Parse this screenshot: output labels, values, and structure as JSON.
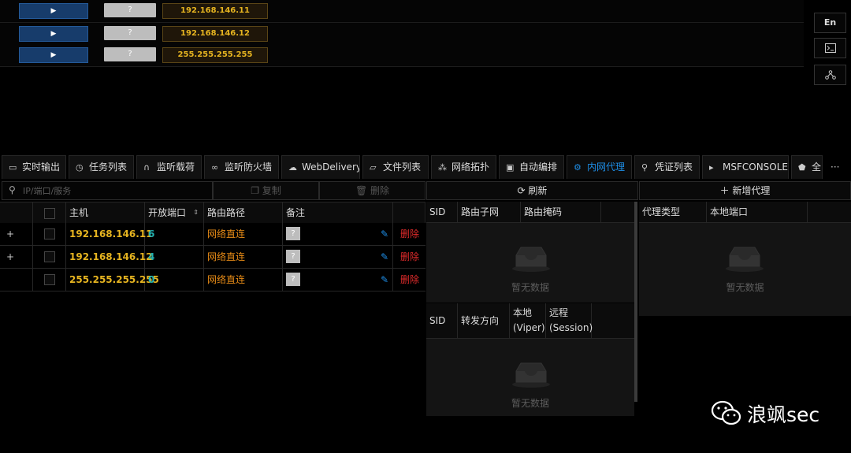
{
  "sessions": [
    {
      "play_label": "▶",
      "note_label": "?",
      "host": "192.168.146.11"
    },
    {
      "play_label": "▶",
      "note_label": "?",
      "host": "192.168.146.12"
    },
    {
      "play_label": "▶",
      "note_label": "?",
      "host": "255.255.255.255"
    }
  ],
  "side_buttons": {
    "lang": "En",
    "terminal_icon": "terminal-icon",
    "network_icon": "network-icon"
  },
  "tabs": [
    {
      "label": "实时输出",
      "icon": "monitor-icon"
    },
    {
      "label": "任务列表",
      "icon": "clock-icon"
    },
    {
      "label": "监听载荷",
      "icon": "headphones-icon"
    },
    {
      "label": "监听防火墙",
      "icon": "link-icon"
    },
    {
      "label": "WebDelivery",
      "icon": "cloud-icon"
    },
    {
      "label": "文件列表",
      "icon": "folder-icon"
    },
    {
      "label": "网络拓扑",
      "icon": "topology-icon"
    },
    {
      "label": "自动编排",
      "icon": "robot-icon"
    },
    {
      "label": "内网代理",
      "icon": "proxy-icon",
      "active": true
    },
    {
      "label": "凭证列表",
      "icon": "key-icon"
    },
    {
      "label": "MSFCONSOLE",
      "icon": "console-icon"
    },
    {
      "label": "全",
      "icon": "gem-icon"
    }
  ],
  "tab_more": "···",
  "host_panel": {
    "search_placeholder": "IP/端口/服务",
    "copy_label": "复制",
    "delete_label": "删除",
    "headers": {
      "host": "主机",
      "ports": "开放端口",
      "route": "路由路径",
      "note": "备注"
    },
    "rows": [
      {
        "expand": "+",
        "host": "192.168.146.11",
        "ports": "6",
        "route": "网络直连",
        "note": "?",
        "delete": "删除"
      },
      {
        "expand": "+",
        "host": "192.168.146.12",
        "ports": "4",
        "route": "网络直连",
        "note": "?",
        "delete": "删除"
      },
      {
        "expand": "",
        "host": "255.255.255.255",
        "ports": "0",
        "route": "网络直连",
        "note": "?",
        "delete": "删除"
      }
    ]
  },
  "route_panel": {
    "refresh_label": "刷新",
    "routes_headers": {
      "sid": "SID",
      "subnet": "路由子网",
      "mask": "路由掩码"
    },
    "routes_empty": "暂无数据",
    "forward_headers": {
      "sid": "SID",
      "direction": "转发方向",
      "local_1": "本地",
      "local_2": "(Viper)",
      "remote_1": "远程",
      "remote_2": "(Session)"
    },
    "forward_empty": "暂无数据"
  },
  "proxy_panel": {
    "add_label": "新增代理",
    "headers": {
      "type": "代理类型",
      "port": "本地端口"
    },
    "empty": "暂无数据"
  },
  "watermark": "浪飒sec",
  "colors": {
    "accent": "#1e8fe8",
    "host_ip": "#e6b420",
    "port": "#22b0b0",
    "route": "#e58a16",
    "delete": "#e02b2b"
  }
}
